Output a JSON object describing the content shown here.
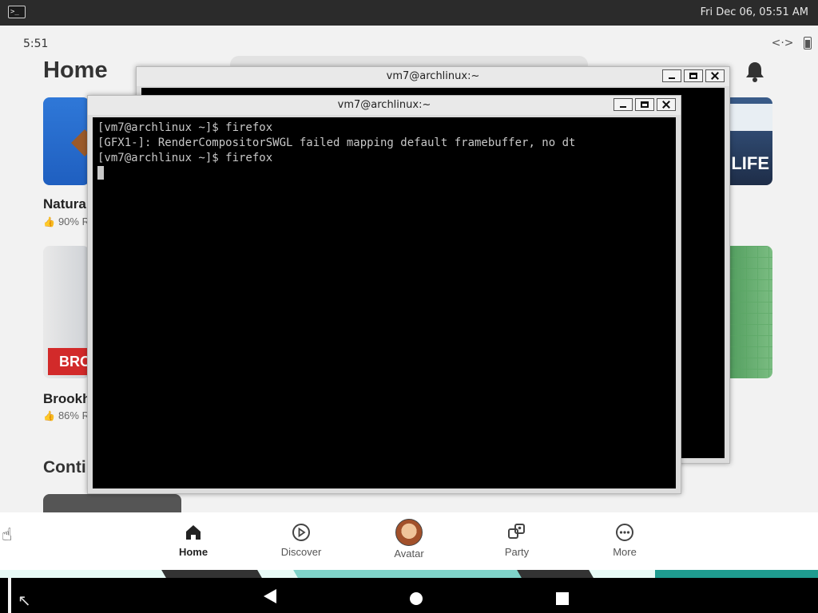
{
  "desktop": {
    "clock": "Fri Dec 06, 05:51 AM",
    "terminal_icon": "terminal-icon"
  },
  "app": {
    "status_time": "5:51",
    "status_icons": "<·>",
    "home_title": "Home",
    "games": [
      {
        "name": "Natura",
        "rating": "90% R"
      },
      {
        "name": "Brookh",
        "rating": "86% R"
      }
    ],
    "tile_texts": {
      "banner": "BROO",
      "life": "LIFE"
    },
    "section_title": "Conti"
  },
  "bottom_nav": {
    "items": [
      {
        "label": "Home",
        "icon": "home-icon",
        "active": true
      },
      {
        "label": "Discover",
        "icon": "play-circle-icon",
        "active": false
      },
      {
        "label": "Avatar",
        "icon": "avatar-icon",
        "active": false
      },
      {
        "label": "Party",
        "icon": "party-icon",
        "active": false
      },
      {
        "label": "More",
        "icon": "more-icon",
        "active": false
      }
    ]
  },
  "terminal_back": {
    "title": "vm7@archlinux:~"
  },
  "terminal_front": {
    "title": "vm7@archlinux:~",
    "lines": [
      "[vm7@archlinux ~]$ firefox",
      "[GFX1-]: RenderCompositorSWGL failed mapping default framebuffer, no dt",
      "[vm7@archlinux ~]$ firefox"
    ]
  },
  "colors": {
    "topbar": "#2b2b2b",
    "terminal_bg": "#000000",
    "terminal_fg": "#c8c8c8",
    "accent_teal": "#1f9c90"
  }
}
